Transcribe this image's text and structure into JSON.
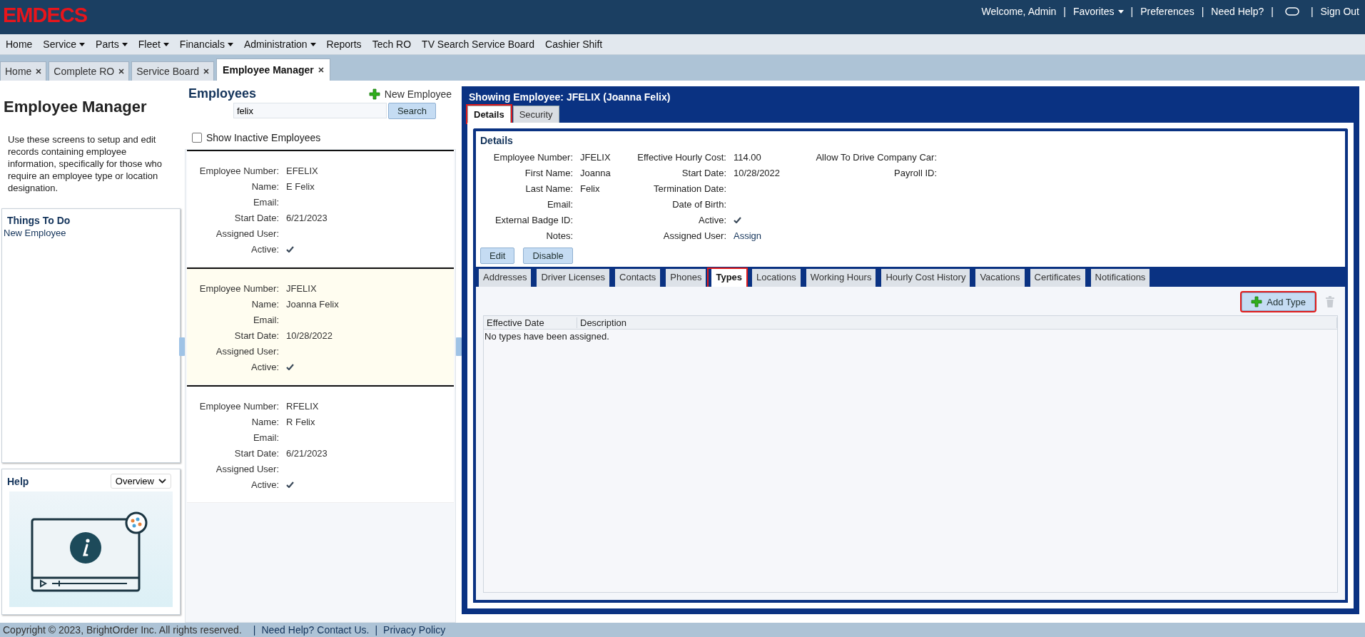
{
  "header": {
    "logo": "EMDECS",
    "links": [
      {
        "kind": "text",
        "label": "Welcome, Admin"
      },
      {
        "kind": "separator",
        "label": "|"
      },
      {
        "kind": "menu",
        "label": "Favorites"
      },
      {
        "kind": "separator",
        "label": "|"
      },
      {
        "kind": "link",
        "label": "Preferences"
      },
      {
        "kind": "separator",
        "label": "|"
      },
      {
        "kind": "link",
        "label": "Need Help?"
      },
      {
        "kind": "separator",
        "label": "|"
      },
      {
        "kind": "chat"
      },
      {
        "kind": "separator",
        "label": "|"
      },
      {
        "kind": "link",
        "label": "Sign Out"
      }
    ]
  },
  "menu": [
    {
      "label": "Home",
      "has_menu": false
    },
    {
      "label": "Service",
      "has_menu": true
    },
    {
      "label": "Parts",
      "has_menu": true
    },
    {
      "label": "Fleet",
      "has_menu": true
    },
    {
      "label": "Financials",
      "has_menu": true
    },
    {
      "label": "Administration",
      "has_menu": true
    },
    {
      "label": "Reports",
      "has_menu": false
    },
    {
      "label": "Tech RO",
      "has_menu": false
    },
    {
      "label": "TV Search Service Board",
      "has_menu": false
    },
    {
      "label": "Cashier Shift",
      "has_menu": false
    }
  ],
  "page_tabs": [
    {
      "label": "Home",
      "selected": false
    },
    {
      "label": "Complete RO",
      "selected": false
    },
    {
      "label": "Service Board",
      "selected": false
    },
    {
      "label": "Employee Manager",
      "selected": true
    }
  ],
  "sidebar": {
    "title": "Employee Manager",
    "description": "Use these screens to setup and edit records containing employee information, specifically for those who require an employee type or location designation.",
    "todo_title": "Things To Do",
    "todo_items": [
      "New Employee"
    ],
    "help_title": "Help",
    "help_select": "Overview"
  },
  "employees": {
    "title": "Employees",
    "new_button": "New Employee",
    "search_value": "felix",
    "search_button": "Search",
    "show_inactive": {
      "label": "Show Inactive Employees",
      "checked": false
    },
    "cards": [
      {
        "selected": false,
        "fields": [
          {
            "label": "Employee Number:",
            "value": "EFELIX"
          },
          {
            "label": "Name:",
            "value": "E Felix"
          },
          {
            "label": "Email:"
          },
          {
            "label": "Start Date:",
            "value": "6/21/2023"
          },
          {
            "label": "Assigned User:"
          },
          {
            "label": "Active:",
            "checked": true
          }
        ]
      },
      {
        "selected": true,
        "fields": [
          {
            "label": "Employee Number:",
            "value": "JFELIX"
          },
          {
            "label": "Name:",
            "value": "Joanna Felix"
          },
          {
            "label": "Email:"
          },
          {
            "label": "Start Date:",
            "value": "10/28/2022"
          },
          {
            "label": "Assigned User:"
          },
          {
            "label": "Active:",
            "checked": true
          }
        ]
      },
      {
        "selected": false,
        "fields": [
          {
            "label": "Employee Number:",
            "value": "RFELIX"
          },
          {
            "label": "Name:",
            "value": "R Felix"
          },
          {
            "label": "Email:"
          },
          {
            "label": "Start Date:",
            "value": "6/21/2023"
          },
          {
            "label": "Assigned User:"
          },
          {
            "label": "Active:",
            "checked": true
          }
        ]
      }
    ]
  },
  "detail": {
    "title": "Showing Employee: JFELIX (Joanna Felix)",
    "tabs": [
      {
        "label": "Details",
        "selected": true,
        "highlighted": true
      },
      {
        "label": "Security",
        "selected": false,
        "highlighted": false
      }
    ],
    "section_title": "Details",
    "columns": [
      [
        {
          "label": "Employee Number:",
          "value": "JFELIX"
        },
        {
          "label": "First Name:",
          "value": "Joanna"
        },
        {
          "label": "Last Name:",
          "value": "Felix"
        },
        {
          "label": "Email:"
        },
        {
          "label": "External Badge ID:"
        },
        {
          "label": "Notes:"
        }
      ],
      [
        {
          "label": "Effective Hourly Cost:",
          "value": "114.00"
        },
        {
          "label": "Start Date:",
          "value": "10/28/2022"
        },
        {
          "label": "Termination Date:"
        },
        {
          "label": "Date of Birth:"
        },
        {
          "label": "Active:",
          "checked": true
        },
        {
          "label": "Assigned User:",
          "link": "Assign"
        }
      ],
      [
        {
          "label": "Allow To Drive Company Car:"
        },
        {
          "label": "Payroll ID:"
        }
      ]
    ],
    "buttons": [
      "Edit",
      "Disable"
    ],
    "sub_tabs": [
      {
        "label": "Addresses",
        "selected": false,
        "highlighted": false
      },
      {
        "label": "Driver Licenses",
        "selected": false,
        "highlighted": false
      },
      {
        "label": "Contacts",
        "selected": false,
        "highlighted": false
      },
      {
        "label": "Phones",
        "selected": false,
        "highlighted": false
      },
      {
        "label": "Types",
        "selected": true,
        "highlighted": true
      },
      {
        "label": "Locations",
        "selected": false,
        "highlighted": false
      },
      {
        "label": "Working Hours",
        "selected": false,
        "highlighted": false
      },
      {
        "label": "Hourly Cost History",
        "selected": false,
        "highlighted": false
      },
      {
        "label": "Vacations",
        "selected": false,
        "highlighted": false
      },
      {
        "label": "Certificates",
        "selected": false,
        "highlighted": false
      },
      {
        "label": "Notifications",
        "selected": false,
        "highlighted": false
      }
    ],
    "add_button": {
      "label": "Add Type",
      "highlighted": true
    },
    "delete_disabled": true,
    "table": {
      "columns": [
        "Effective Date",
        "Description"
      ],
      "empty_message": "No types have been assigned."
    }
  },
  "footer": [
    {
      "kind": "text",
      "label": "Copyright © 2023, BrightOrder Inc. All rights reserved."
    },
    {
      "kind": "separator",
      "label": "|"
    },
    {
      "kind": "link",
      "label": "Need Help? Contact Us."
    },
    {
      "kind": "separator",
      "label": "|"
    },
    {
      "kind": "link",
      "label": "Privacy Policy"
    }
  ]
}
